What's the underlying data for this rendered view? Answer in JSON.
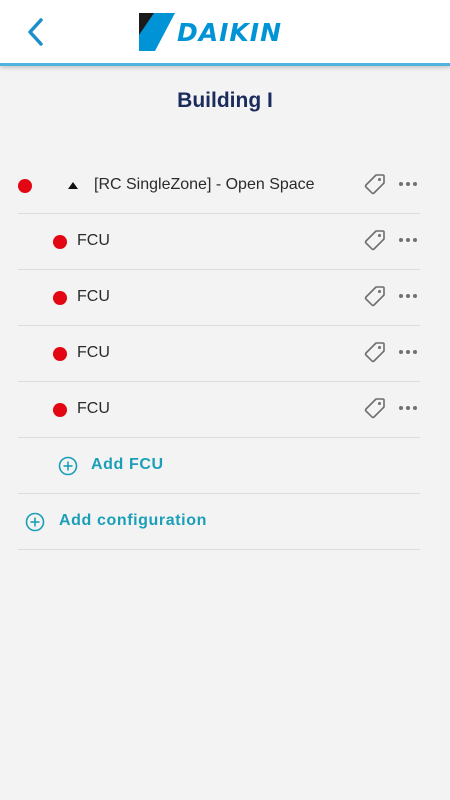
{
  "header": {
    "back_icon": "chevron-left-icon",
    "logo_text": "DAIKIN"
  },
  "page": {
    "title": "Building I"
  },
  "configuration": {
    "label": "[RC SingleZone] - Open Space",
    "status": "error",
    "status_color": "#e30613",
    "expanded": true,
    "units": [
      {
        "label": "FCU",
        "status_color": "#e30613"
      },
      {
        "label": "FCU",
        "status_color": "#e30613"
      },
      {
        "label": "FCU",
        "status_color": "#e30613"
      },
      {
        "label": "FCU",
        "status_color": "#e30613"
      }
    ],
    "add_unit_label": "Add FCU"
  },
  "add_configuration_label": "Add configuration",
  "colors": {
    "accent": "#1b9fb8",
    "header_bar": "#4fb3dd",
    "brand_blue": "#0094d6",
    "title": "#1a2b5c",
    "status_red": "#e30613"
  }
}
